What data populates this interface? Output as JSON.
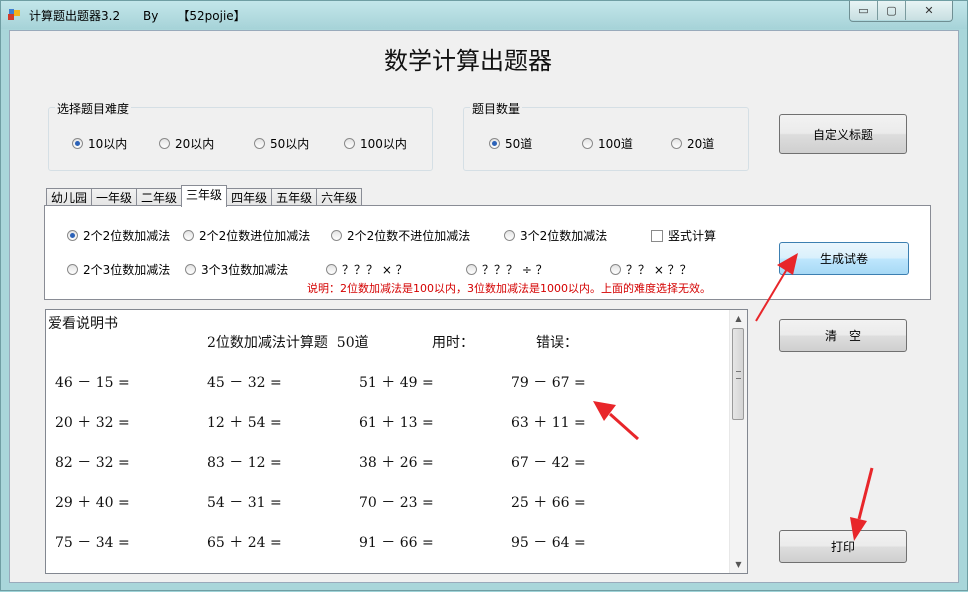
{
  "window": {
    "title": "计算题出题器3.2      By     【52pojie】",
    "min_symbol": "▭",
    "max_symbol": "▢",
    "close_symbol": "✕"
  },
  "heading": "数学计算出题器",
  "difficulty": {
    "legend": "选择题目难度",
    "options": [
      "10以内",
      "20以内",
      "50以内",
      "100以内"
    ],
    "selected": 0
  },
  "quantity": {
    "legend": "题目数量",
    "options": [
      "50道",
      "100道",
      "20道"
    ],
    "selected": 0
  },
  "buttons": {
    "custom_title": "自定义标题",
    "generate": "生成试卷",
    "clear": "清　空",
    "print": "打印"
  },
  "tabs": [
    "幼儿园",
    "一年级",
    "二年级",
    "三年级",
    "四年级",
    "五年级",
    "六年级"
  ],
  "active_tab": 3,
  "problem_types": {
    "row1": [
      "2个2位数加减法",
      "2个2位数进位加减法",
      "2个2位数不进位加减法",
      "3个2位数加减法"
    ],
    "row2": [
      "2个3位数加减法",
      "3个3位数加减法",
      "？？？ × ？",
      "？？？ ÷ ？",
      "？？ × ？？"
    ],
    "selected": "row1.0",
    "vertical_label": "竖式计算",
    "note": "说明：2位数加减法是100以内，3位数加减法是1000以内。上面的难度选择无效。"
  },
  "document": {
    "intro": "爱看说明书",
    "title": "2位数加减法计算题  50道",
    "time_label": "用时：",
    "error_label": "错误：",
    "problems": [
      [
        "46 － 15 =",
        "45 － 32 =",
        "51 ＋ 49 =",
        "79 － 67 ="
      ],
      [
        "20 ＋ 32 =",
        "12 ＋ 54 =",
        "61 ＋ 13 =",
        "63 ＋ 11 ="
      ],
      [
        "82 － 32 =",
        "83 － 12 =",
        "38 ＋ 26 =",
        "67 － 42 ="
      ],
      [
        "29 ＋ 40 =",
        "54 － 31 =",
        "70 － 23 =",
        "25 ＋ 66 ="
      ],
      [
        "75 － 34 =",
        "65 ＋ 24 =",
        "91 － 66 =",
        "95 － 64 ="
      ]
    ]
  },
  "scroll": {
    "up_symbol": "▲",
    "down_symbol": "▼"
  },
  "colors": {
    "window_frame": "#a9d6da",
    "note_text": "#d40000",
    "annotation_arrow": "#e8262a",
    "radio_selected": "#2c62b8"
  }
}
